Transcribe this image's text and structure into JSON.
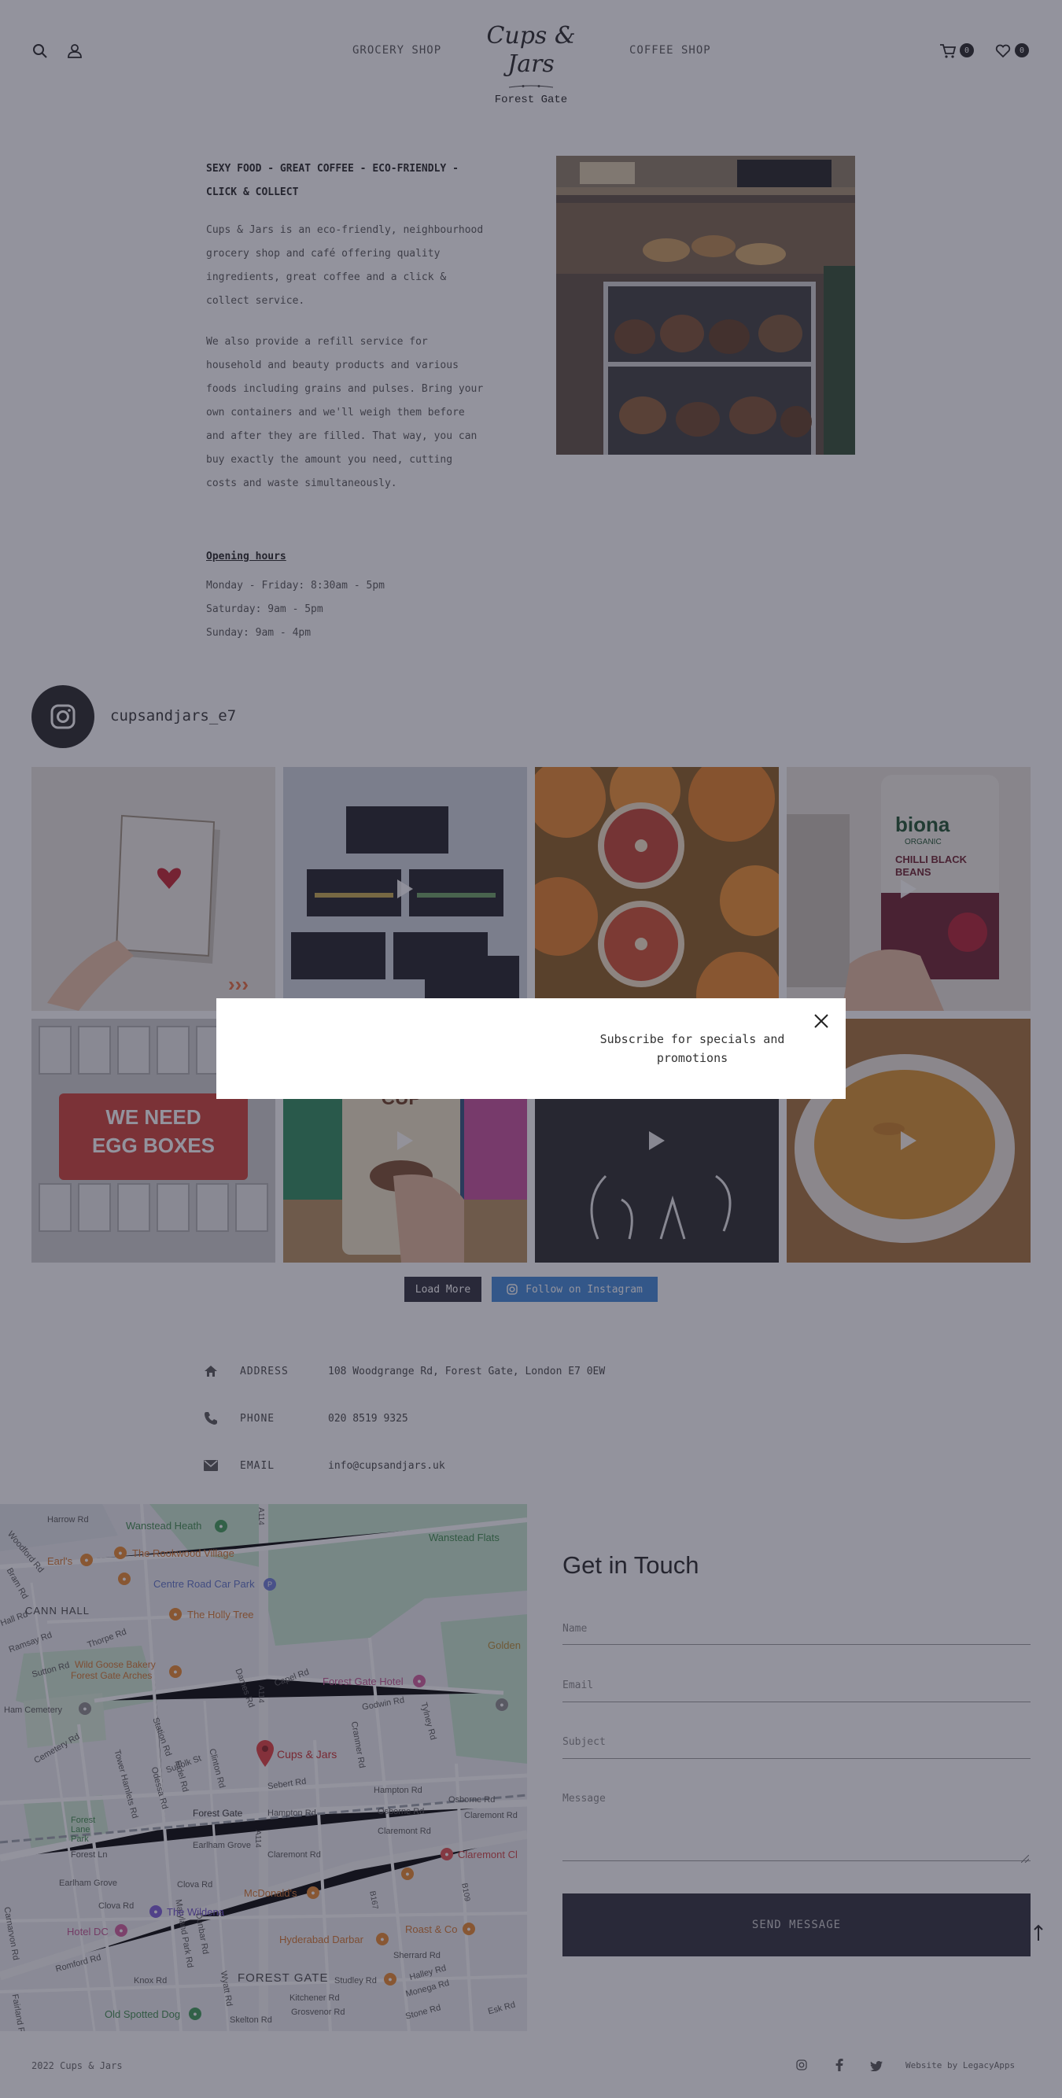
{
  "header": {
    "nav_left": "GROCERY SHOP",
    "nav_right": "COFFEE SHOP",
    "logo_script": "Cups & Jars",
    "logo_sub": "Forest Gate",
    "cart_count": "0",
    "wishlist_count": "0"
  },
  "intro": {
    "title_1": "SEXY FOOD - GREAT COFFEE - ECO-FRIENDLY -",
    "title_2": "CLICK & COLLECT",
    "p1": [
      "Cups & Jars is an eco-friendly, neighbourhood",
      "grocery shop and café offering quality",
      "ingredients, great coffee and a click &",
      "collect service."
    ],
    "p2": [
      "We also provide a refill service for",
      "household and beauty products and various",
      "foods including grains and pulses. Bring your",
      "own containers and we'll weigh them before",
      "and after they are filled. That way, you can",
      "buy exactly the amount you need, cutting",
      "costs and waste simultaneously."
    ]
  },
  "hours": {
    "title": "Opening hours",
    "lines": [
      "Monday - Friday: 8:30am - 5pm",
      "Saturday: 9am - 5pm",
      "Sunday: 9am - 4pm"
    ]
  },
  "instagram": {
    "handle": "cupsandjars_e7",
    "load_more": "Load More",
    "follow": "Follow on Instagram",
    "tile_texts": {
      "biona_1": "biona",
      "biona_2": "ORGANIC",
      "biona_3": "CHILLI BLACK BEANS",
      "egg_1": "WE NEED",
      "egg_2": "EGG BOXES",
      "barley": "BARLEY CUP"
    }
  },
  "contact": {
    "address_label": "ADDRESS",
    "address": "108 Woodgrange Rd, Forest Gate, London E7 0EW",
    "phone_label": "PHONE",
    "phone": "020 8519 9325",
    "email_label": "EMAIL",
    "email": "info@cupsandjars.uk"
  },
  "map": {
    "pois": {
      "cups": "Cups & Jars",
      "rookwood": "The Rookwood Village",
      "holly": "The Holly Tree",
      "carpark": "Centre Road Car Park",
      "wanstead_heath": "Wanstead Heath",
      "wanstead_flats": "Wanstead Flats",
      "bakery_1": "Wild Goose Bakery",
      "bakery_2": "Forest Gate Arches",
      "hotel": "Forest Gate Hotel",
      "mcd": "McDonald's",
      "hyderabad": "Hyderabad Darbar",
      "roast": "Roast & Co",
      "wildena": "The Wildena",
      "hotel_dc": "Hotel DC",
      "spotted": "Old Spotted Dog",
      "claremont": "Claremont Cl",
      "golden": "Golden",
      "earls": "Earl's"
    },
    "labels": {
      "harrow": "Harrow Rd",
      "cann_hall": "CANN HALL",
      "forest_gate_area": "FOREST GATE",
      "forest_gate_station": "Forest Gate",
      "ham_cem": "Ham Cemetery",
      "forest_lane_park": "Forest Lane Park",
      "forest_ln": "Forest Ln",
      "dames": "Dames Rd",
      "capel": "Capel Rd",
      "godwin": "Godwin Rd",
      "selsdon": "Selsdon Rd",
      "hampton": "Hampton Rd",
      "osborne": "Osborne Rd",
      "claremont": "Claremont Rd",
      "earlham": "Earlham Grove",
      "romford": "Romford Rd",
      "clova": "Clova Rd",
      "a114": "A114",
      "b167": "B167",
      "b109": "B109",
      "sebert": "Sebert Rd",
      "station": "Station Rd",
      "suffolk": "Suffolk St",
      "tower_hamlets": "Tower Hamlets Rd",
      "clinton": "Clinton Rd",
      "knox": "Knox Rd",
      "skelton": "Skelton Rd",
      "grosvenor": "Grosvenor Rd",
      "kitchener": "Kitchener Rd",
      "stone": "Stone Rd",
      "esk": "Esk Rd",
      "cranmer": "Cranmer Rd",
      "tylney": "Tylney Rd",
      "sherrard": "Sherrard Rd",
      "halley": "Halley Rd",
      "monega": "Monega Rd",
      "studley": "Studley Rd",
      "thorpe": "Thorpe Rd",
      "cemetery": "Cemetery Rd",
      "fidel": "Fidel Rd",
      "odessa": "Odessa Rd",
      "hall": "Hall Rd",
      "woodford": "Woodford Rd",
      "ramsay": "Ramsay Rd",
      "bram": "Bram Rd",
      "maryland": "Maryland Park Rd",
      "wyatt": "Wyatt Rd",
      "dunbar": "Dunbar Rd",
      "sutton": "Sutton Rd",
      "carnarvon": "Carnarvon Rd",
      "fairland": "Fairland Rd"
    }
  },
  "form": {
    "title": "Get in Touch",
    "name": "Name",
    "email": "Email",
    "subject": "Subject",
    "message": "Message",
    "send": "SEND MESSAGE"
  },
  "footer": {
    "copyright": "2022 Cups & Jars",
    "credit": "Website by LegacyApps"
  },
  "modal": {
    "text_1": "Subscribe for specials and",
    "text_2": "promotions"
  }
}
